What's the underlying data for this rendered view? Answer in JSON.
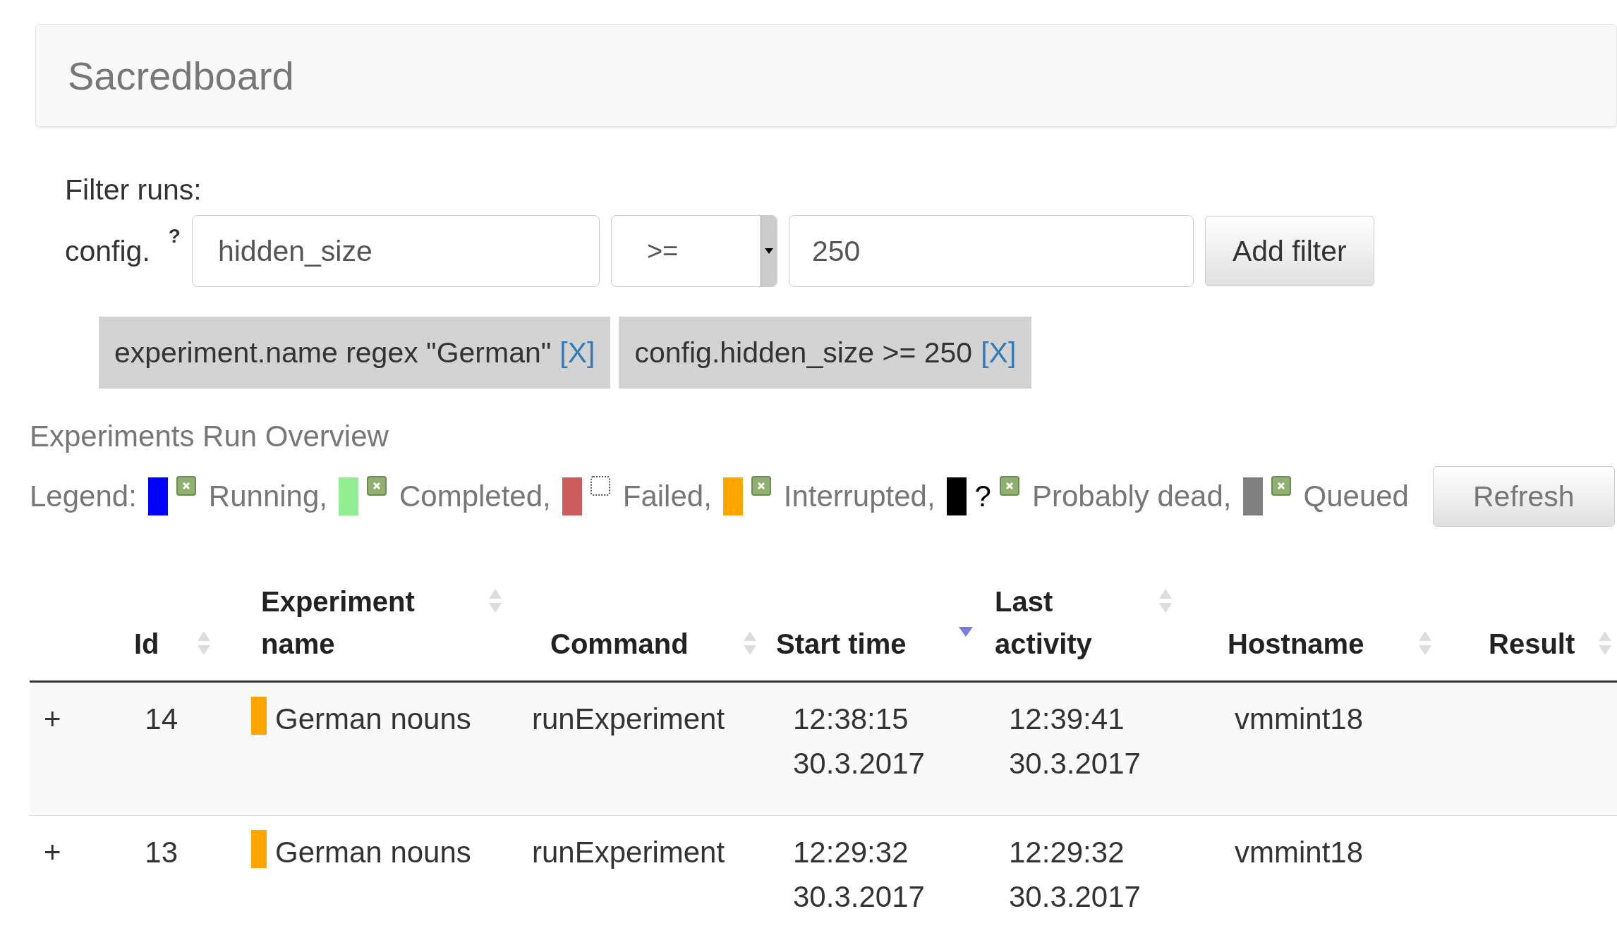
{
  "header": {
    "title": "Sacredboard"
  },
  "filter": {
    "heading": "Filter runs:",
    "prefix": "config.",
    "help_mark": "?",
    "field": {
      "value": "hidden_size"
    },
    "operator": {
      "value": ">="
    },
    "value_field": {
      "value": "250"
    },
    "add_button": "Add filter"
  },
  "active_filters": [
    {
      "text": "experiment.name regex \"German\"",
      "remove": "[X]"
    },
    {
      "text": "config.hidden_size >= 250",
      "remove": "[X]"
    }
  ],
  "overview": {
    "title": "Experiments Run Overview",
    "legend_label": "Legend:",
    "refresh_button": "Refresh"
  },
  "legend": [
    {
      "label": "Running,",
      "color": "#0000ff",
      "checked": true
    },
    {
      "label": "Completed,",
      "color": "#90ee90",
      "checked": true
    },
    {
      "label": "Failed,",
      "color": "#cd5c5c",
      "checked": false
    },
    {
      "label": "Interrupted,",
      "color": "#ffa500",
      "checked": true
    },
    {
      "label": "Probably dead,",
      "color": "#000000",
      "checked": true,
      "mark": "?"
    },
    {
      "label": "Queued",
      "color": "#808080",
      "checked": true
    }
  ],
  "table": {
    "columns": [
      {
        "label": "Id",
        "sorted": false
      },
      {
        "label": "Experiment name",
        "sorted": false
      },
      {
        "label": "Command",
        "sorted": false
      },
      {
        "label": "Start time",
        "sorted": true
      },
      {
        "label": "Last activity",
        "sorted": false
      },
      {
        "label": "Hostname",
        "sorted": false
      },
      {
        "label": "Result",
        "sorted": false
      }
    ],
    "rows": [
      {
        "expand": "+",
        "id": "14",
        "color": "#ffa500",
        "name": "German nouns",
        "command": "runExperiment",
        "start": [
          "12:38:15",
          "30.3.2017"
        ],
        "last": [
          "12:39:41",
          "30.3.2017"
        ],
        "host": "vmmint18"
      },
      {
        "expand": "+",
        "id": "13",
        "color": "#ffa500",
        "name": "German nouns",
        "command": "runExperiment",
        "start": [
          "12:29:32",
          "30.3.2017"
        ],
        "last": [
          "12:29:32",
          "30.3.2017"
        ],
        "host": "vmmint18"
      }
    ]
  }
}
